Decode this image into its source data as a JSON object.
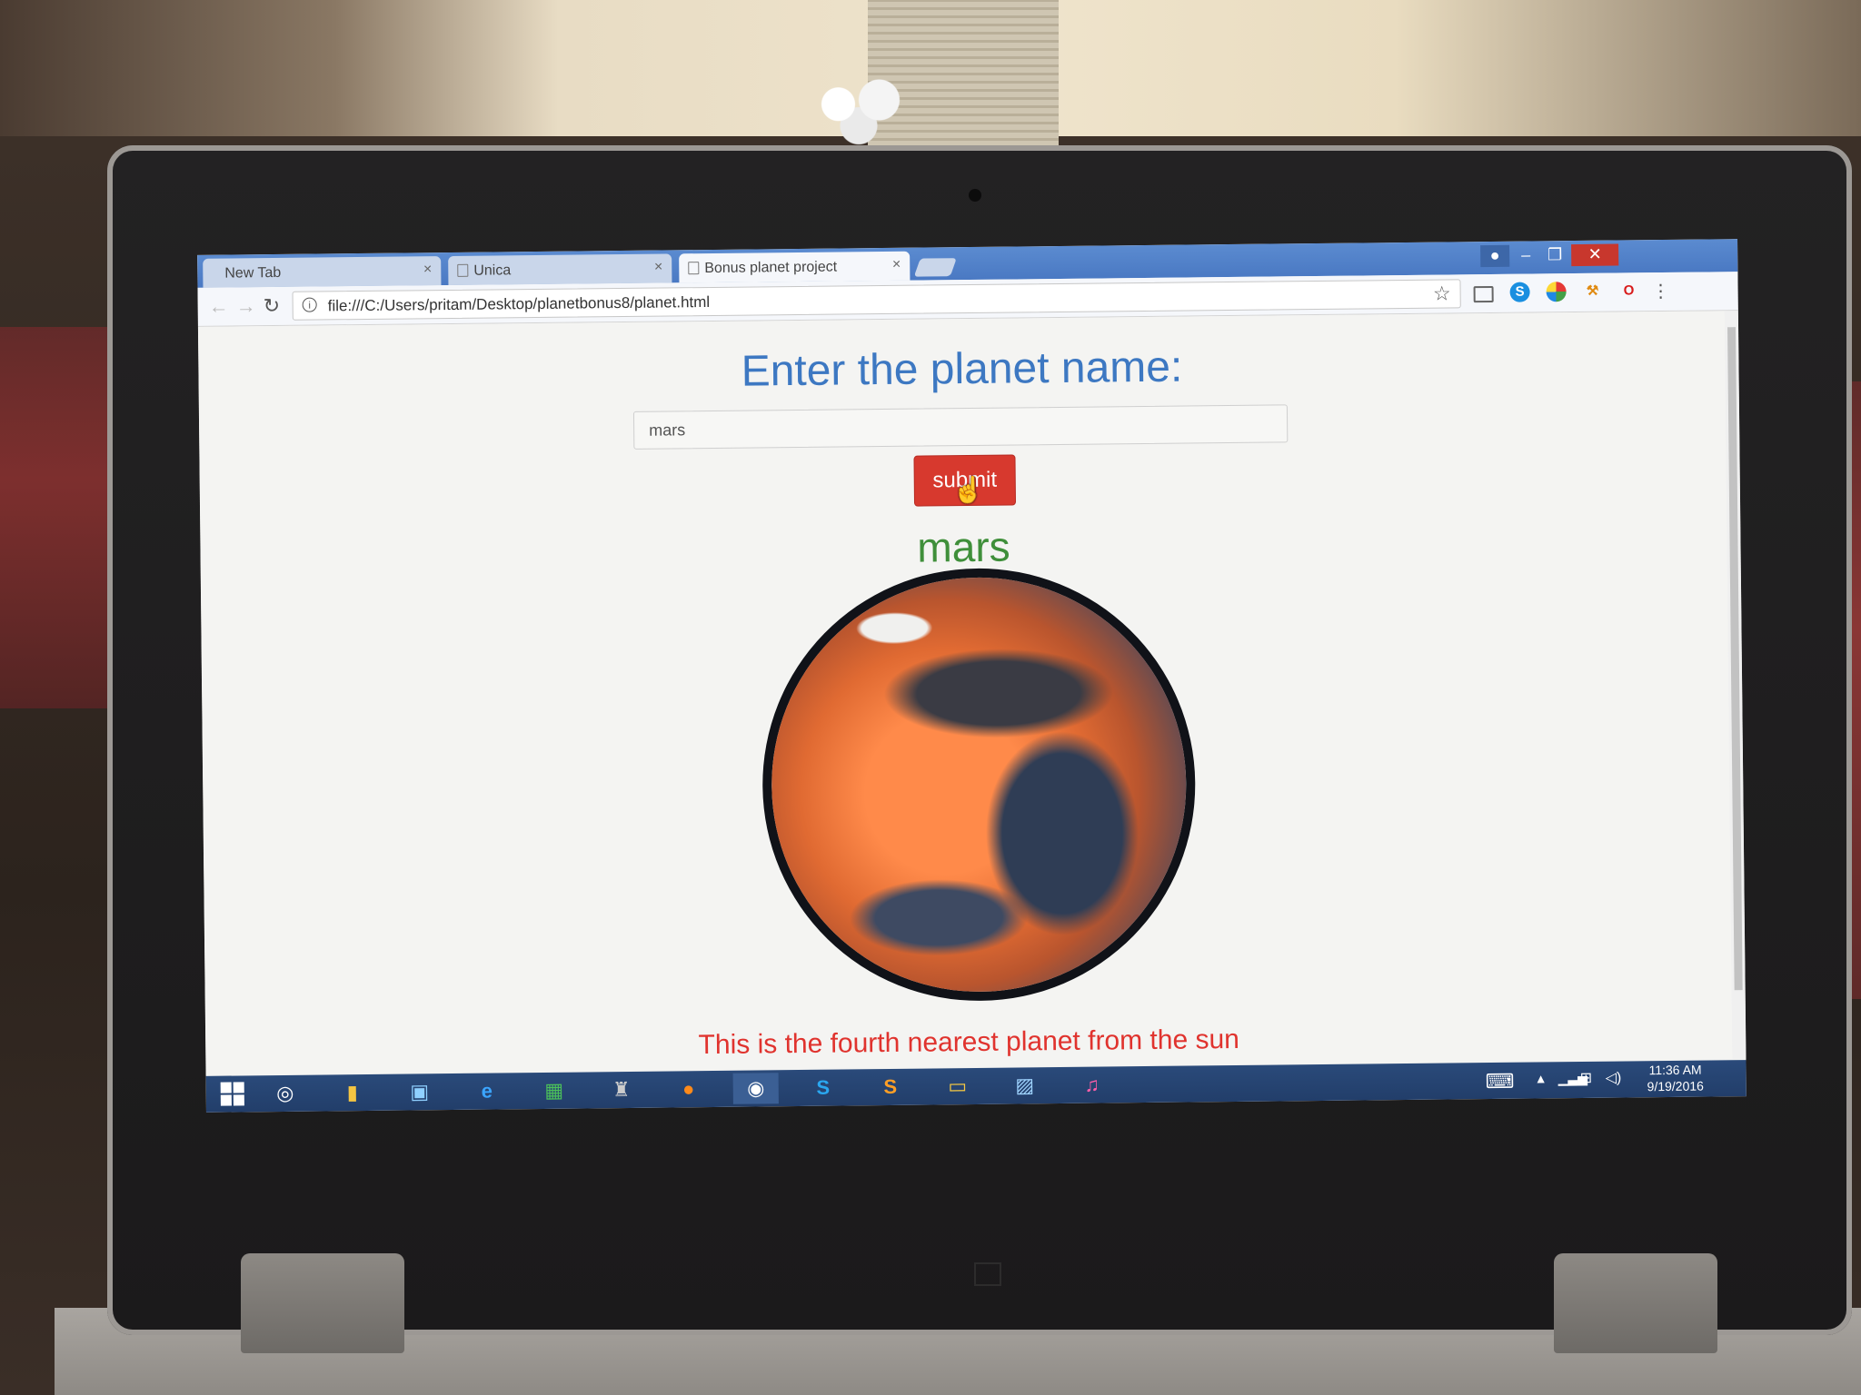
{
  "browser": {
    "tabs": [
      {
        "label": "New Tab",
        "close": "×"
      },
      {
        "label": "Unica",
        "close": "×"
      },
      {
        "label": "Bonus planet project",
        "close": "×"
      }
    ],
    "url": "file:///C:/Users/pritam/Desktop/planetbonus8/planet.html"
  },
  "page": {
    "heading": "Enter the planet name:",
    "input_value": "mars",
    "submit_label": "submit",
    "planet_name": "mars",
    "description": "This is the fourth nearest planet from the sun"
  },
  "taskbar": {
    "time": "11:36 AM",
    "date": "9/19/2016"
  },
  "colors": {
    "heading": "#3d78c2",
    "planet_name": "#3f8f3a",
    "description": "#e0332e",
    "submit_button": "#d7392e"
  }
}
